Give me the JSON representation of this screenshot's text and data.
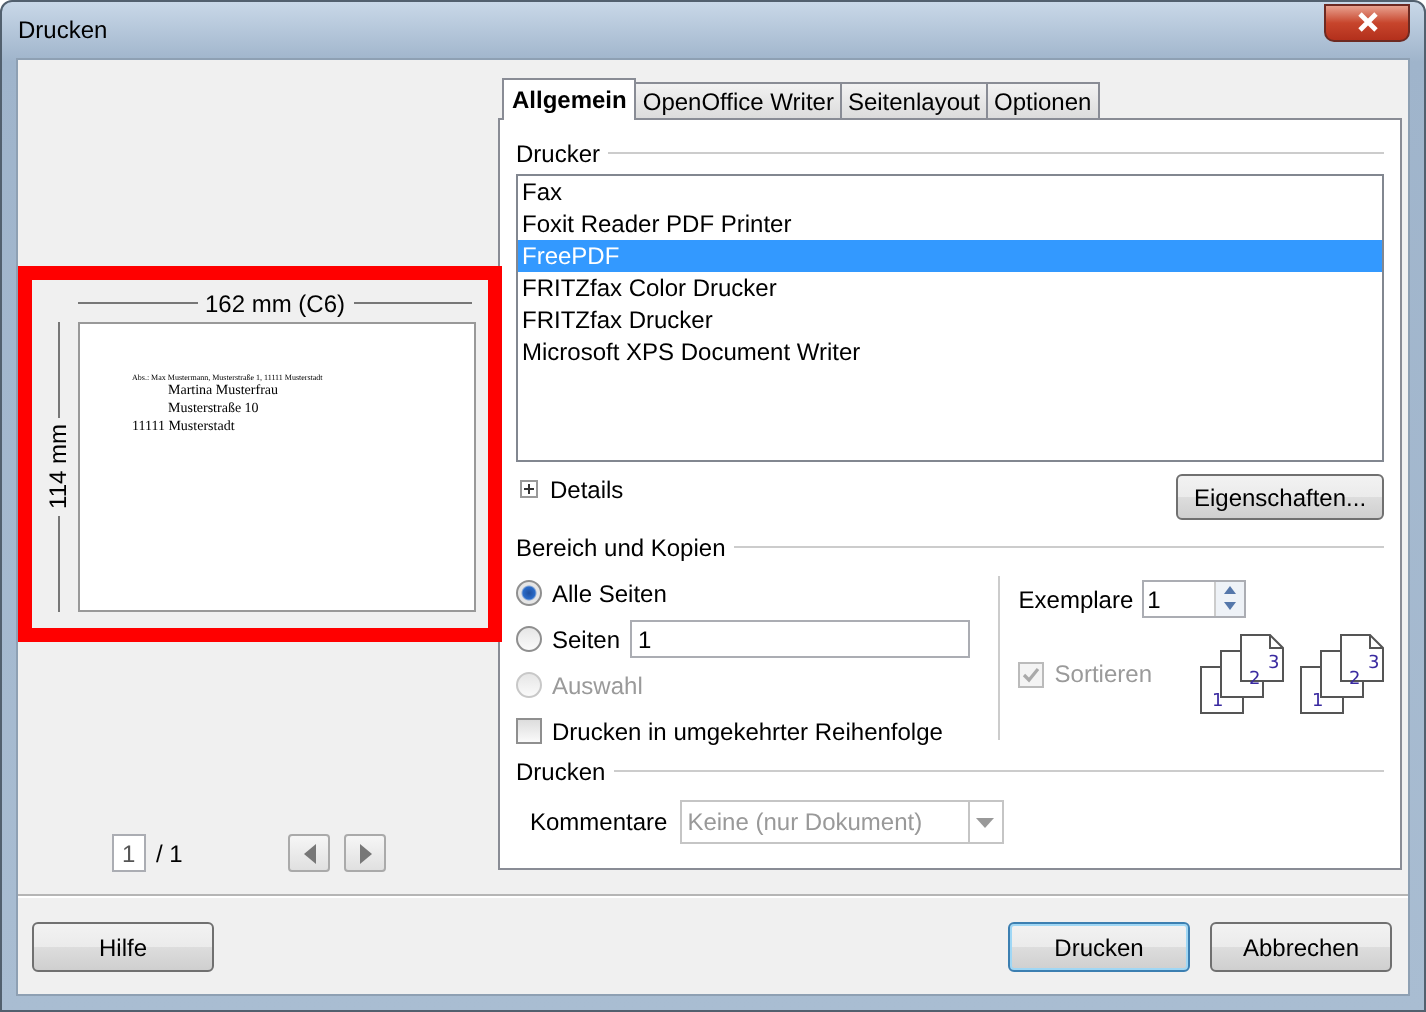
{
  "window": {
    "title": "Drucken"
  },
  "preview": {
    "width_label": "162 mm (C6)",
    "height_label": "114 mm",
    "sender": "Abs.: Max Mustermann, Musterstraße 1, 11111 Musterstadt",
    "recipient": [
      "Martina Musterfrau",
      "Musterstraße 10"
    ],
    "city": "11111 Musterstadt",
    "page_field": "1",
    "page_total": "/ 1"
  },
  "tabs": [
    {
      "label": "Allgemein",
      "selected": true
    },
    {
      "label": "OpenOffice Writer",
      "selected": false
    },
    {
      "label": "Seitenlayout",
      "selected": false
    },
    {
      "label": "Optionen",
      "selected": false
    }
  ],
  "printer": {
    "heading": "Drucker",
    "printers": [
      {
        "label": "Fax",
        "selected": false
      },
      {
        "label": "Foxit Reader PDF Printer",
        "selected": false
      },
      {
        "label": "FreePDF",
        "selected": true
      },
      {
        "label": "FRITZfax Color Drucker",
        "selected": false
      },
      {
        "label": "FRITZfax Drucker",
        "selected": false
      },
      {
        "label": "Microsoft XPS Document Writer",
        "selected": false
      }
    ],
    "details": "Details",
    "details_expanded": false,
    "properties_button": "Eigenschaften..."
  },
  "range": {
    "heading": "Bereich und Kopien",
    "options": [
      {
        "label": "Alle Seiten",
        "selected": true,
        "disabled": false
      },
      {
        "label": "Seiten",
        "selected": false,
        "disabled": false,
        "value": "1"
      },
      {
        "label": "Auswahl",
        "selected": false,
        "disabled": true
      }
    ],
    "reverse": {
      "label": "Drucken in umgekehrter Reihenfolge",
      "checked": false
    },
    "copies_label": "Exemplare",
    "copies": "1",
    "collate": {
      "label": "Sortieren",
      "checked": true,
      "disabled": true
    },
    "stacks": [
      {
        "pages": [
          "1",
          "2",
          "3"
        ]
      },
      {
        "pages": [
          "1",
          "2",
          "3"
        ]
      }
    ]
  },
  "print": {
    "heading": "Drucken",
    "comments_label": "Kommentare",
    "comments_value": "Keine (nur Dokument)",
    "comments_disabled": true
  },
  "buttons": [
    {
      "label": "Hilfe",
      "default": false
    },
    {
      "label": "Drucken",
      "default": true
    },
    {
      "label": "Abbrechen",
      "default": false
    }
  ]
}
